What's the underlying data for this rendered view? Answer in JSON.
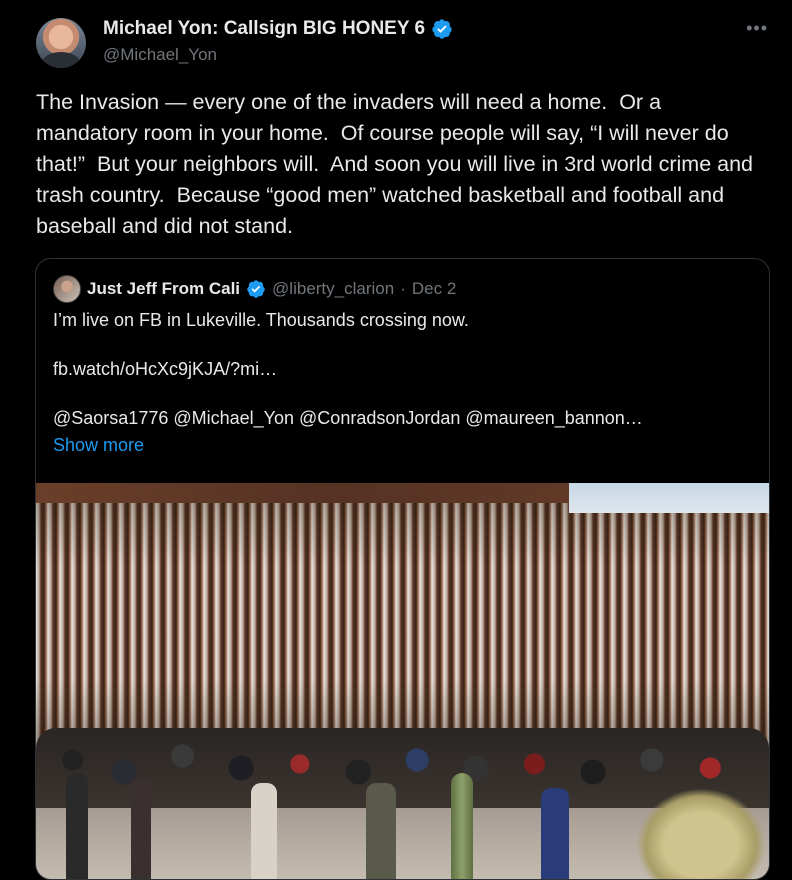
{
  "tweet": {
    "author_name": "Michael Yon: Callsign BIG HONEY 6",
    "handle": "@Michael_Yon",
    "more_icon": "more-horizontal-icon",
    "text": "The Invasion — every one of the invaders will need a home.  Or a mandatory room in your home.  Of course people will say, “I will never do that!”  But your neighbors will.  And soon you will live in 3rd world crime and trash country.  Because “good men” watched basketball and football and baseball and did not stand."
  },
  "quote": {
    "author_name": "Just Jeff From Cali",
    "handle": "@liberty_clarion",
    "separator": "·",
    "date": "Dec 2",
    "line1": "I’m live on FB in Lukeville. Thousands crossing now.",
    "link": "fb.watch/oHcXc9jKJA/?mi…",
    "mentions": "@Saorsa1776 @Michael_Yon @ConradsonJordan @maureen_bannon…",
    "show_more": "Show more"
  },
  "colors": {
    "background": "#000000",
    "text": "#e7e9ea",
    "secondary": "#71767b",
    "link": "#1d9bf0",
    "border": "#2f3336",
    "verified": "#1d9bf0"
  }
}
